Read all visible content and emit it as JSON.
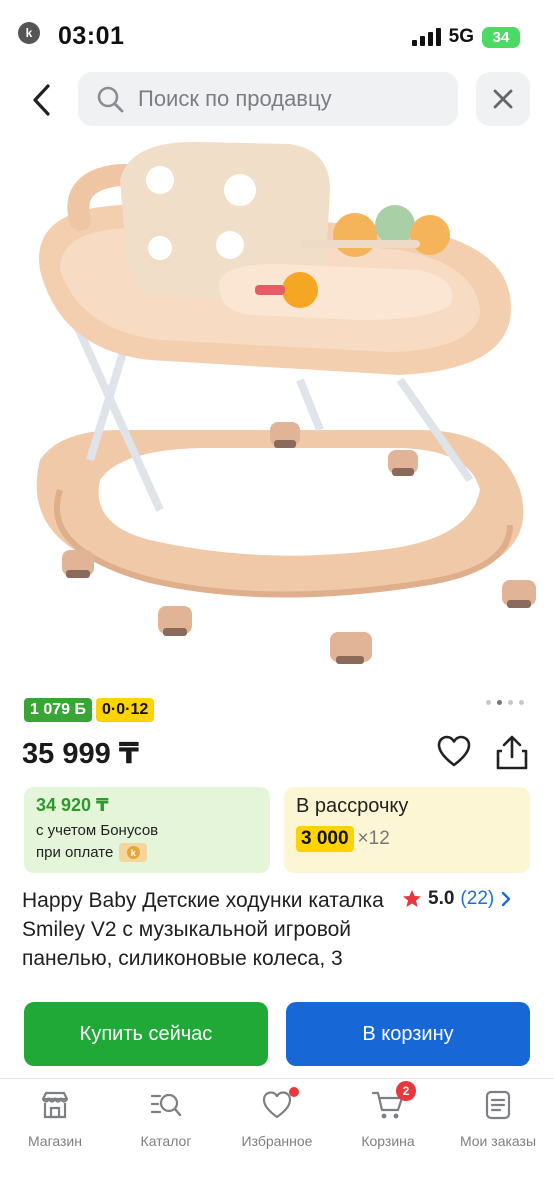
{
  "status_bar": {
    "time": "03:01",
    "network": "5G",
    "battery": "34",
    "app_glyph": "k"
  },
  "search": {
    "placeholder": "Поиск по продавцу"
  },
  "product": {
    "image_dots": 4,
    "image_dot_active": 1,
    "bonus_badge": "1 079 Б",
    "installment_badge": "0·0·12",
    "price": "35 999 ₸",
    "bonus_card": {
      "value": "34 920 ₸",
      "line1": "с учетом Бонусов",
      "line2": "при оплате"
    },
    "installment_card": {
      "title": "В рассрочку",
      "amount": "3 000",
      "months": "×12"
    },
    "title": "Happy Baby Детские ходунки каталка Smiley V2 с музыкальной игровой панелью, силиконовые колеса, 3",
    "rating": {
      "score": "5.0",
      "count": "(22)"
    }
  },
  "actions": {
    "buy_now": "Купить сейчас",
    "add_to_cart": "В корзину"
  },
  "nav": {
    "items": [
      {
        "label": "Магазин",
        "icon": "store-icon"
      },
      {
        "label": "Каталог",
        "icon": "catalog-search-icon"
      },
      {
        "label": "Избранное",
        "icon": "heart-icon"
      },
      {
        "label": "Корзина",
        "icon": "cart-icon",
        "badge": "2"
      },
      {
        "label": "Мои заказы",
        "icon": "orders-icon"
      }
    ]
  },
  "colors": {
    "accent_green": "#21a938",
    "accent_blue": "#1767d6",
    "installment_yellow": "#ffd300",
    "badge_red": "#e8383d"
  }
}
